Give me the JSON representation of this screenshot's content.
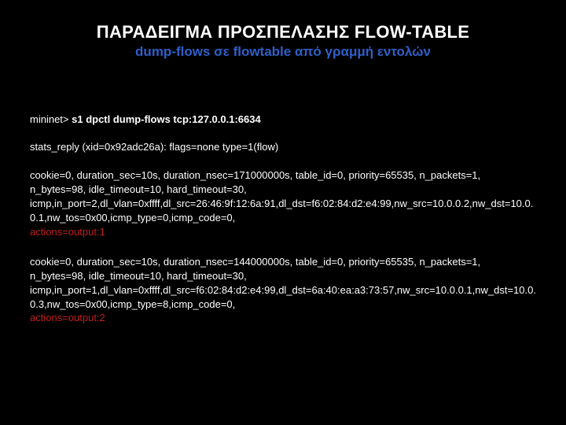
{
  "title": "ΠΑΡΑΔΕΙΓΜΑ ΠΡΟΣΠΕΛΑΣΗΣ FLOW-TABLE",
  "subtitle": "dump-flows σε flowtable από γραμμή εντολών",
  "prompt": "mininet> ",
  "command": "s1 dpctl dump-flows tcp:127.0.0.1:6634",
  "stats_reply": "stats_reply (xid=0x92adc26a): flags=none type=1(flow)",
  "flows": [
    {
      "body": "cookie=0, duration_sec=10s, duration_nsec=171000000s, table_id=0, priority=65535, n_packets=1, n_bytes=98, idle_timeout=10, hard_timeout=30, icmp,in_port=2,dl_vlan=0xffff,dl_src=26:46:9f:12:6a:91,dl_dst=f6:02:84:d2:e4:99,nw_src=10.0.0.2,nw_dst=10.0.0.1,nw_tos=0x00,icmp_type=0,icmp_code=0,",
      "actions": "actions=output:1"
    },
    {
      "body": "cookie=0, duration_sec=10s, duration_nsec=144000000s, table_id=0, priority=65535, n_packets=1, n_bytes=98, idle_timeout=10, hard_timeout=30, icmp,in_port=1,dl_vlan=0xffff,dl_src=f6:02:84:d2:e4:99,dl_dst=6a:40:ea:a3:73:57,nw_src=10.0.0.1,nw_dst=10.0.0.3,nw_tos=0x00,icmp_type=8,icmp_code=0,",
      "actions": "actions=output:2"
    }
  ]
}
